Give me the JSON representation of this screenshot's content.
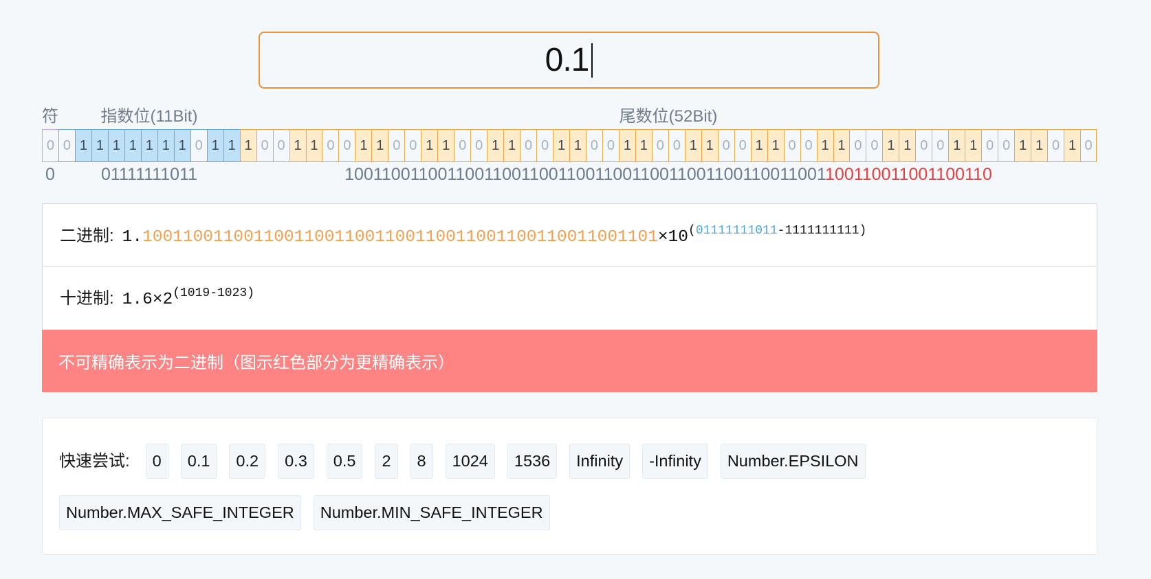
{
  "input": {
    "value": "0.1"
  },
  "bits": {
    "labels": {
      "sign": "符",
      "exponent": "指数位(11Bit)",
      "mantissa": "尾数位(52Bit)"
    },
    "sign": "0",
    "exponent": "01111111011",
    "mantissa": "1001100110011001100110011001100110011001100110011010",
    "readout": {
      "sign": "0",
      "exponent": "01111111011",
      "mantissa_stored": "1001100110011001100110011001100110011001100110011001",
      "mantissa_more_precise": "100110011001100110"
    }
  },
  "binary": {
    "label": "二进制:",
    "prefix": "1.",
    "mantissa": "100110011001100110011001100110011001100110011001101",
    "times": "×10",
    "sup_open": "(",
    "sup_biased_exponent": "01111111011",
    "sup_rest": "-1111111111)"
  },
  "decimal": {
    "label": "十进制:",
    "value": "1.6×2",
    "sup": "(1019-1023)"
  },
  "warning": "不可精确表示为二进制（图示红色部分为更精确表示）",
  "quick_try": {
    "label": "快速尝试:",
    "options": [
      "0",
      "0.1",
      "0.2",
      "0.3",
      "0.5",
      "2",
      "8",
      "1024",
      "1536",
      "Infinity",
      "-Infinity",
      "Number.EPSILON",
      "Number.MAX_SAFE_INTEGER",
      "Number.MIN_SAFE_INTEGER"
    ]
  },
  "colors": {
    "input_border": "#f0913c",
    "sign_border": "#c9a3ee",
    "exponent_border": "#62abe4",
    "exponent_fill": "#bfe1f7",
    "mantissa_border": "#f5a444",
    "mantissa_fill": "#feebc9",
    "mantissa_text": "#f5a04e",
    "exponent_text": "#4ea5e0",
    "extra_bits": "#e53e3e",
    "warning_bg": "#fd8482"
  }
}
